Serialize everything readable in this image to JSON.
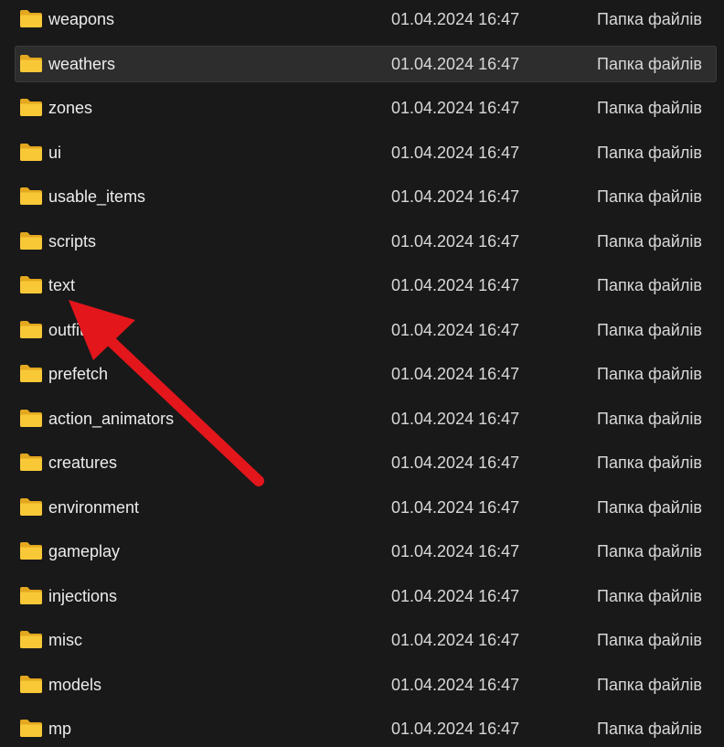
{
  "files": [
    {
      "name": "weapons",
      "date": "01.04.2024 16:47",
      "type": "Папка файлів",
      "icon": "folder-icon",
      "selected": false
    },
    {
      "name": "weathers",
      "date": "01.04.2024 16:47",
      "type": "Папка файлів",
      "icon": "folder-icon",
      "selected": true
    },
    {
      "name": "zones",
      "date": "01.04.2024 16:47",
      "type": "Папка файлів",
      "icon": "folder-icon",
      "selected": false
    },
    {
      "name": "ui",
      "date": "01.04.2024 16:47",
      "type": "Папка файлів",
      "icon": "folder-icon",
      "selected": false
    },
    {
      "name": "usable_items",
      "date": "01.04.2024 16:47",
      "type": "Папка файлів",
      "icon": "folder-icon",
      "selected": false
    },
    {
      "name": "scripts",
      "date": "01.04.2024 16:47",
      "type": "Папка файлів",
      "icon": "folder-icon",
      "selected": false
    },
    {
      "name": "text",
      "date": "01.04.2024 16:47",
      "type": "Папка файлів",
      "icon": "folder-icon",
      "selected": false
    },
    {
      "name": "outfits",
      "date": "01.04.2024 16:47",
      "type": "Папка файлів",
      "icon": "folder-icon",
      "selected": false
    },
    {
      "name": "prefetch",
      "date": "01.04.2024 16:47",
      "type": "Папка файлів",
      "icon": "folder-icon",
      "selected": false
    },
    {
      "name": "action_animators",
      "date": "01.04.2024 16:47",
      "type": "Папка файлів",
      "icon": "folder-icon",
      "selected": false
    },
    {
      "name": "creatures",
      "date": "01.04.2024 16:47",
      "type": "Папка файлів",
      "icon": "folder-icon",
      "selected": false
    },
    {
      "name": "environment",
      "date": "01.04.2024 16:47",
      "type": "Папка файлів",
      "icon": "folder-icon",
      "selected": false
    },
    {
      "name": "gameplay",
      "date": "01.04.2024 16:47",
      "type": "Папка файлів",
      "icon": "folder-icon",
      "selected": false
    },
    {
      "name": "injections",
      "date": "01.04.2024 16:47",
      "type": "Папка файлів",
      "icon": "folder-icon",
      "selected": false
    },
    {
      "name": "misc",
      "date": "01.04.2024 16:47",
      "type": "Папка файлів",
      "icon": "folder-icon",
      "selected": false
    },
    {
      "name": "models",
      "date": "01.04.2024 16:47",
      "type": "Папка файлів",
      "icon": "folder-icon",
      "selected": false
    },
    {
      "name": "mp",
      "date": "01.04.2024 16:47",
      "type": "Папка файлів",
      "icon": "folder-icon",
      "selected": false
    }
  ],
  "annotation": {
    "icon": "red-arrow-icon",
    "color": "#e3161c"
  },
  "colors": {
    "background": "#191919",
    "selected_row": "#2d2d2d",
    "folder_front": "#f8c837",
    "folder_back": "#e3a81f",
    "text": "#ececec"
  }
}
